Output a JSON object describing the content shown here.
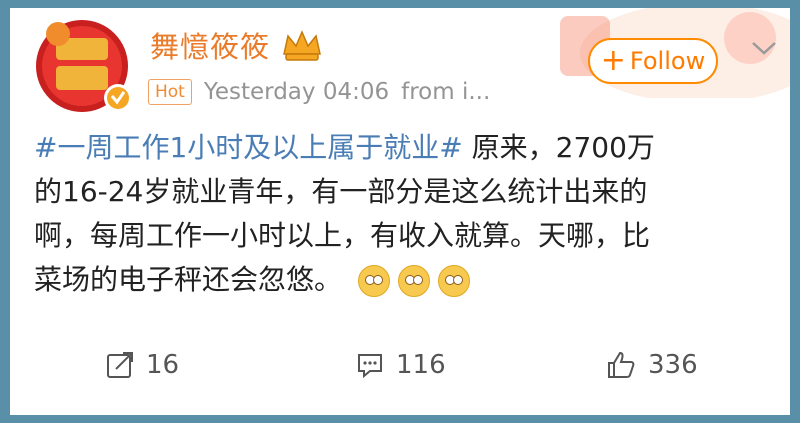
{
  "user": {
    "name": "舞憶筱筱"
  },
  "meta": {
    "badge": "Hot",
    "timestamp": "Yesterday 04:06",
    "source": "from i..."
  },
  "follow": {
    "label": "Follow"
  },
  "post": {
    "topic": "#一周工作1小时及以上属于就业#",
    "line1_rest": " 原来，2700万",
    "line2": "的16-24岁就业青年，有一部分是这么统计出来的",
    "line3": "啊，每周工作一小时以上，有收入就算。天哪，比",
    "line4": "菜场的电子秤还会忽悠。"
  },
  "actions": {
    "repost_count": "16",
    "comment_count": "116",
    "like_count": "336"
  },
  "colors": {
    "accent": "#ff8a00",
    "name": "#ea7b2a",
    "topic": "#4a7db5",
    "frame": "#5a8fa8"
  }
}
